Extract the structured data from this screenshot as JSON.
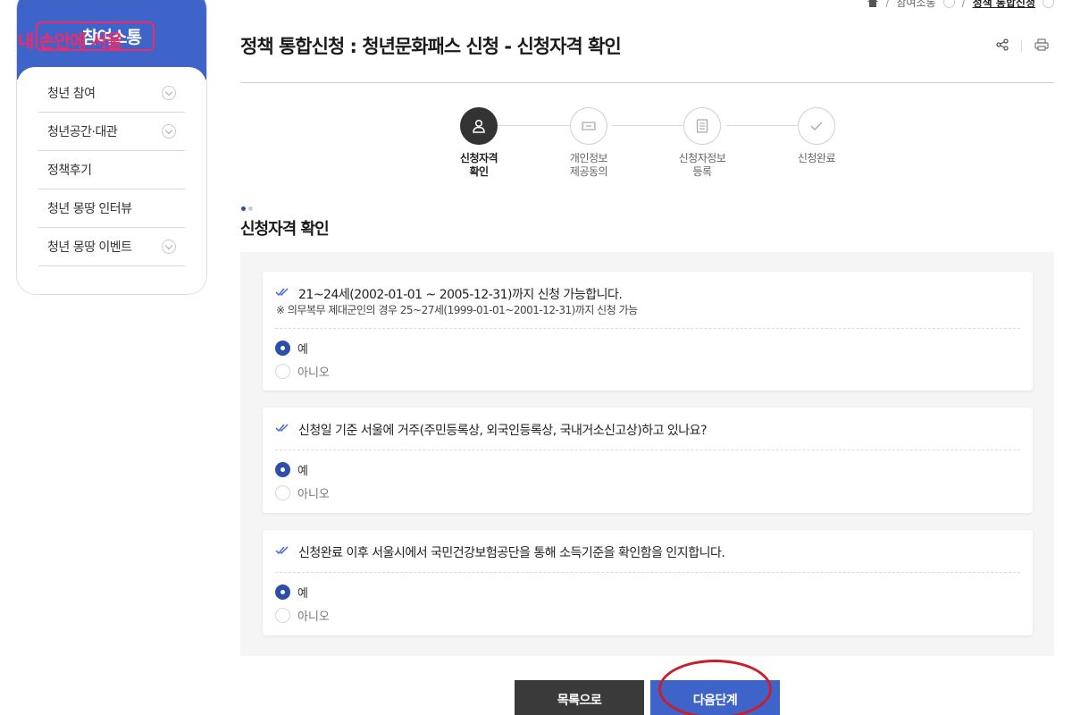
{
  "sidebar": {
    "header_title": "참여소통",
    "watermark": "내 손안에 서울",
    "items": [
      {
        "label": "청년 참여",
        "expandable": true
      },
      {
        "label": "청년공간·대관",
        "expandable": true
      },
      {
        "label": "정책후기",
        "expandable": false
      },
      {
        "label": "청년 몽땅 인터뷰",
        "expandable": false
      },
      {
        "label": "청년 몽땅 이벤트",
        "expandable": true
      }
    ]
  },
  "breadcrumb": {
    "parent": "참여소통",
    "current": "정책 통합신청"
  },
  "page": {
    "title": "정책 통합신청 : 청년문화패스 신청 - 신청자격 확인"
  },
  "steps": [
    {
      "label": "신청자격\n확인",
      "icon": "person-icon",
      "active": true
    },
    {
      "label": "개인정보\n제공동의",
      "icon": "ticket-icon",
      "active": false
    },
    {
      "label": "신청자정보\n등록",
      "icon": "document-icon",
      "active": false
    },
    {
      "label": "신청완료",
      "icon": "check-icon",
      "active": false
    }
  ],
  "section": {
    "title": "신청자격 확인"
  },
  "questions": [
    {
      "text": "21~24세(2002-01-01 ~ 2005-12-31)까지 신청 가능합니다.",
      "note": "※ 의무복무 제대군인의 경우 25~27세(1999-01-01~2001-12-31)까지 신청 가능",
      "options": [
        {
          "label": "예",
          "selected": true
        },
        {
          "label": "아니오",
          "selected": false
        }
      ]
    },
    {
      "text": "신청일 기준 서울에 거주(주민등록상, 외국인등록상, 국내거소신고상)하고 있나요?",
      "note": "",
      "options": [
        {
          "label": "예",
          "selected": true
        },
        {
          "label": "아니오",
          "selected": false
        }
      ]
    },
    {
      "text": "신청완료 이후 서울시에서 국민건강보험공단을 통해 소득기준을 확인함을 인지합니다.",
      "note": "",
      "options": [
        {
          "label": "예",
          "selected": true
        },
        {
          "label": "아니오",
          "selected": false
        }
      ]
    }
  ],
  "buttons": {
    "list": "목록으로",
    "next": "다음단계"
  },
  "colors": {
    "primary": "#3e63c9",
    "dark_button": "#3a3a3a",
    "watermark": "#ee2a6a",
    "annotation": "#c81f2d"
  }
}
